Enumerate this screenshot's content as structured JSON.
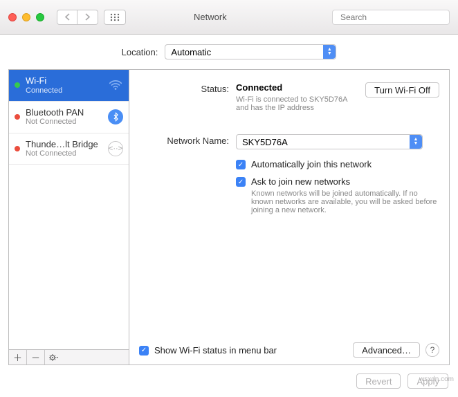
{
  "toolbar": {
    "title": "Network",
    "search_placeholder": "Search"
  },
  "location": {
    "label": "Location:",
    "value": "Automatic"
  },
  "sidebar": {
    "items": [
      {
        "title": "Wi-Fi",
        "subtitle": "Connected",
        "status": "green"
      },
      {
        "title": "Bluetooth PAN",
        "subtitle": "Not Connected",
        "status": "red"
      },
      {
        "title": "Thunde…lt Bridge",
        "subtitle": "Not Connected",
        "status": "red"
      }
    ]
  },
  "detail": {
    "status_label": "Status:",
    "status_value": "Connected",
    "turn_off_label": "Turn Wi-Fi Off",
    "status_sub": "Wi-Fi is connected to SKY5D76A and has the IP address",
    "network_name_label": "Network Name:",
    "network_name_value": "SKY5D76A",
    "auto_join": "Automatically join this network",
    "ask_join": "Ask to join new networks",
    "ask_join_sub": "Known networks will be joined automatically. If no known networks are available, you will be asked before joining a new network.",
    "show_menubar": "Show Wi-Fi status in menu bar",
    "advanced": "Advanced…"
  },
  "footer": {
    "revert": "Revert",
    "apply": "Apply"
  },
  "watermark": "wsxdn.com"
}
